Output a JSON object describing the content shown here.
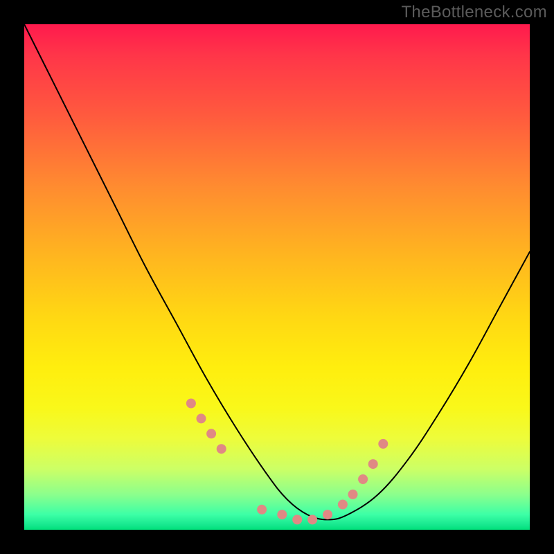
{
  "watermark": "TheBottleneck.com",
  "chart_data": {
    "type": "line",
    "title": "",
    "xlabel": "",
    "ylabel": "",
    "xlim": [
      0,
      100
    ],
    "ylim": [
      0,
      100
    ],
    "series": [
      {
        "name": "bottleneck-curve",
        "x": [
          0,
          6,
          12,
          18,
          24,
          30,
          36,
          42,
          48,
          52,
          56,
          60,
          64,
          70,
          76,
          82,
          88,
          94,
          100
        ],
        "values": [
          100,
          88,
          76,
          64,
          52,
          41,
          30,
          20,
          11,
          6,
          3,
          2,
          3,
          7,
          14,
          23,
          33,
          44,
          55
        ]
      }
    ],
    "markers": {
      "name": "highlight-dots",
      "x": [
        33,
        35,
        37,
        39,
        47,
        51,
        54,
        57,
        60,
        63,
        65,
        67,
        69,
        71
      ],
      "values": [
        25,
        22,
        19,
        16,
        4,
        3,
        2,
        2,
        3,
        5,
        7,
        10,
        13,
        17
      ],
      "color": "#e08984",
      "radius_px": 7
    },
    "gradient_stops_pct": {
      "top_red": 0,
      "mid_yellow": 60,
      "bottom_green": 100
    }
  }
}
